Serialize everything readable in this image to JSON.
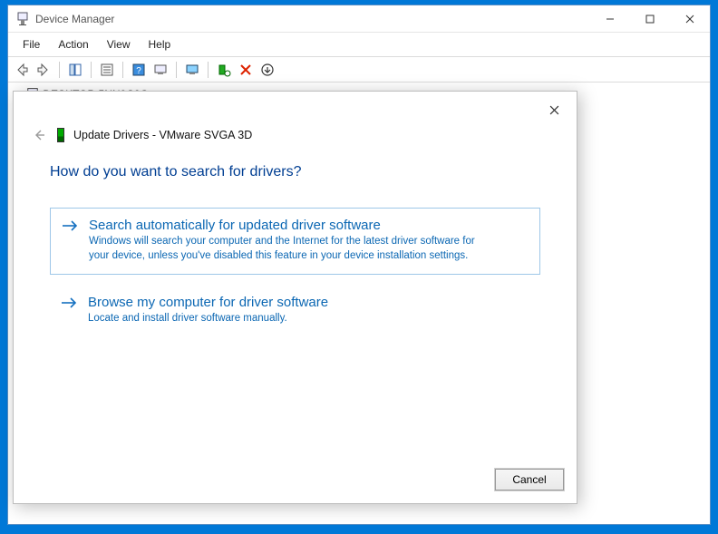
{
  "window": {
    "title": "Device Manager"
  },
  "menu": {
    "file": "File",
    "action": "Action",
    "view": "View",
    "help": "Help"
  },
  "tree": {
    "root": "DESKTOP-5NN0C0G"
  },
  "dialog": {
    "subtitle": "Update Drivers - VMware SVGA 3D",
    "question": "How do you want to search for drivers?",
    "options": [
      {
        "title": "Search automatically for updated driver software",
        "desc": "Windows will search your computer and the Internet for the latest driver software for your device, unless you've disabled this feature in your device installation settings."
      },
      {
        "title": "Browse my computer for driver software",
        "desc": "Locate and install driver software manually."
      }
    ],
    "cancel": "Cancel"
  }
}
